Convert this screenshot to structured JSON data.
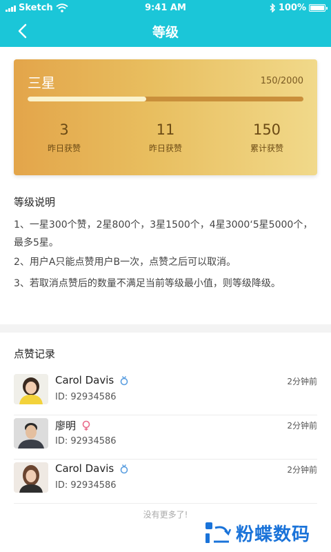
{
  "status_bar": {
    "carrier": "Sketch",
    "time": "9:41 AM",
    "battery": "100%"
  },
  "nav": {
    "title": "等级"
  },
  "level_card": {
    "level_name": "三星",
    "progress_text": "150/2000",
    "progress_fraction": 0.43,
    "stats": [
      {
        "value": "3",
        "label": "昨日获赞"
      },
      {
        "value": "11",
        "label": "昨日获赞"
      },
      {
        "value": "150",
        "label": "累计获赞"
      }
    ]
  },
  "rules": {
    "title": "等级说明",
    "items": [
      "1、一星300个赞，2星800个，3星1500个，4星3000‘5星5000个，最多5星。",
      "2、用户A只能点赞用户B一次，点赞之后可以取消。",
      "3、若取消点赞后的数量不满足当前等级最小值，则等级降级。"
    ]
  },
  "records": {
    "title": "点赞记录",
    "items": [
      {
        "name": "Carol Davis",
        "gender": "male",
        "id": "ID:  92934586",
        "time": "2分钟前"
      },
      {
        "name": "廖明",
        "gender": "female",
        "id": "ID:  92934586",
        "time": "2分钟前"
      },
      {
        "name": "Carol Davis",
        "gender": "male",
        "id": "ID:  92934586",
        "time": "2分钟前"
      }
    ],
    "no_more": "没有更多了!"
  },
  "watermark": {
    "text": "粉蝶数码"
  },
  "colors": {
    "header": "#1bc6d8",
    "card_start": "#e3a54a",
    "card_end": "#f1d98a",
    "male": "#5a9ee0",
    "female": "#e96a8a",
    "watermark": "#1a73d9"
  }
}
